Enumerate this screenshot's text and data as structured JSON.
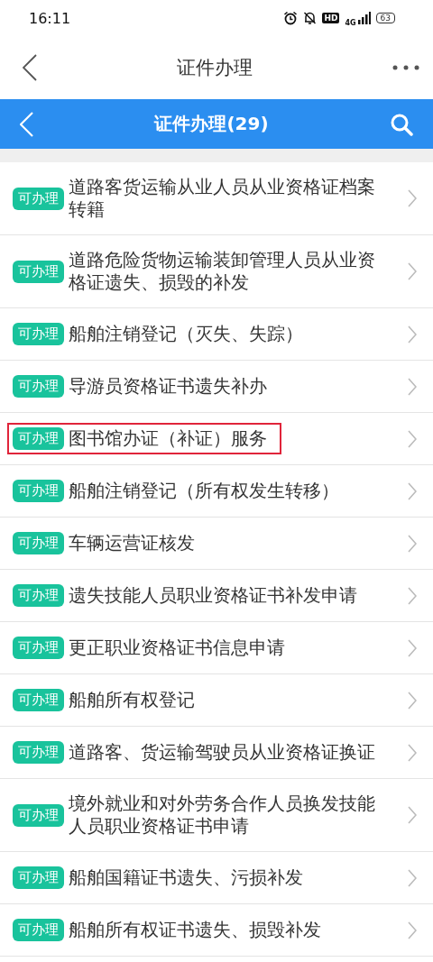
{
  "status_bar": {
    "time": "16:11",
    "hd": "HD",
    "network": "4G",
    "battery": "63"
  },
  "nav_bar": {
    "title": "证件办理"
  },
  "header": {
    "title": "证件办理(29)"
  },
  "items": [
    {
      "badge": "可办理",
      "title": "道路客货运输从业人员从业资格证档案转籍",
      "highlighted": false
    },
    {
      "badge": "可办理",
      "title": "道路危险货物运输装卸管理人员从业资格证遗失、损毁的补发",
      "highlighted": false
    },
    {
      "badge": "可办理",
      "title": "船舶注销登记（灭失、失踪）",
      "highlighted": false
    },
    {
      "badge": "可办理",
      "title": "导游员资格证书遗失补办",
      "highlighted": false
    },
    {
      "badge": "可办理",
      "title": "图书馆办证（补证）服务",
      "highlighted": true
    },
    {
      "badge": "可办理",
      "title": "船舶注销登记（所有权发生转移）",
      "highlighted": false
    },
    {
      "badge": "可办理",
      "title": "车辆运营证核发",
      "highlighted": false
    },
    {
      "badge": "可办理",
      "title": "遗失技能人员职业资格证书补发申请",
      "highlighted": false
    },
    {
      "badge": "可办理",
      "title": "更正职业资格证书信息申请",
      "highlighted": false
    },
    {
      "badge": "可办理",
      "title": "船舶所有权登记",
      "highlighted": false
    },
    {
      "badge": "可办理",
      "title": "道路客、货运输驾驶员从业资格证换证",
      "highlighted": false
    },
    {
      "badge": "可办理",
      "title": "境外就业和对外劳务合作人员换发技能人员职业资格证书申请",
      "highlighted": false
    },
    {
      "badge": "可办理",
      "title": "船舶国籍证书遗失、污损补发",
      "highlighted": false
    },
    {
      "badge": "可办理",
      "title": "船舶所有权证书遗失、损毁补发",
      "highlighted": false
    }
  ]
}
